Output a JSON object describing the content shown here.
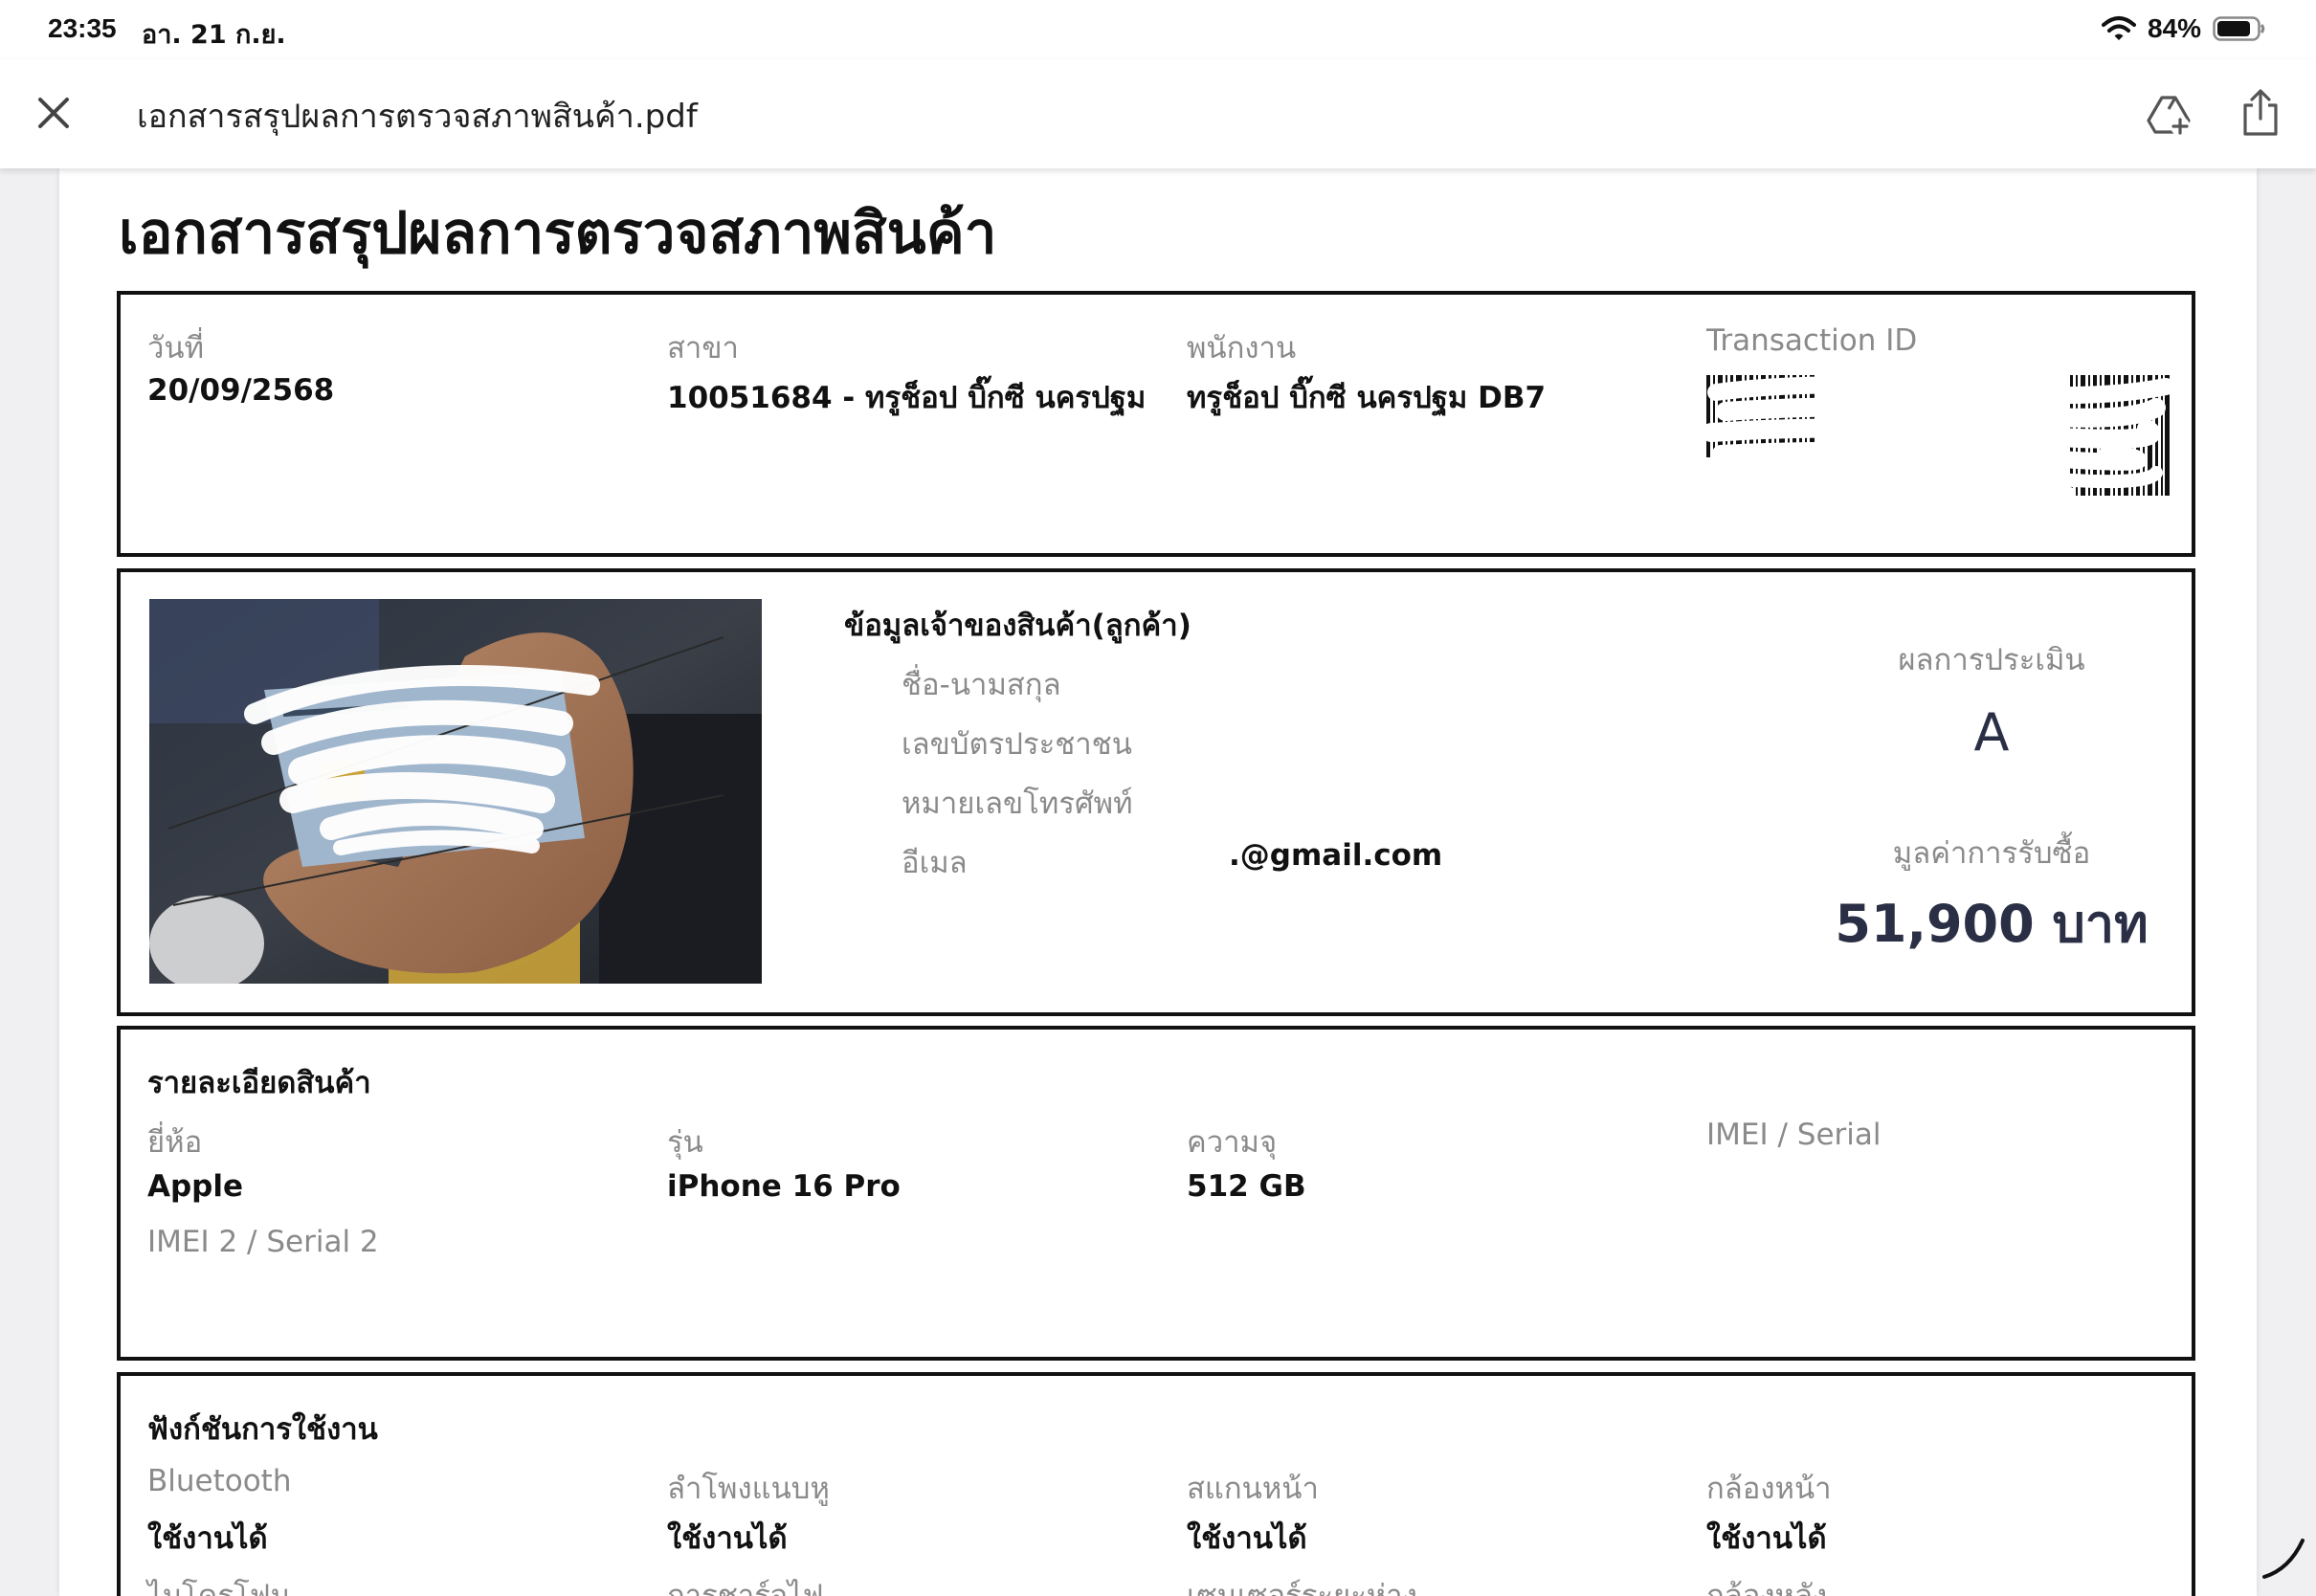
{
  "status_bar": {
    "time": "23:35",
    "date": "อา. 21 ก.ย.",
    "battery": "84%"
  },
  "nav": {
    "title": "เอกสารสรุปผลการตรวจสภาพสินค้า.pdf"
  },
  "document": {
    "title": "เอกสารสรุปผลการตรวจสภาพสินค้า",
    "transaction": {
      "date_label": "วันที่",
      "date_value": "20/09/2568",
      "branch_label": "สาขา",
      "branch_value": "10051684 - ทรูช็อป บิ๊กซี นครปฐม",
      "staff_label": "พนักงาน",
      "staff_value": "ทรูช็อป บิ๊กซี นครปฐม DB7",
      "transaction_id_label": "Transaction ID"
    },
    "customer": {
      "heading": "ข้อมูลเจ้าของสินค้า(ลูกค้า)",
      "name_label": "ชื่อ-นามสกุล",
      "id_card_label": "เลขบัตรประชาชน",
      "phone_label": "หมายเลขโทรศัพท์",
      "email_label": "อีเมล",
      "email_value": ".@gmail.com",
      "grade_label": "ผลการประเมิน",
      "grade_value": "A",
      "price_label": "มูลค่าการรับซื้อ",
      "price_value": "51,900 บาท"
    },
    "product": {
      "heading": "รายละเอียดสินค้า",
      "brand_label": "ยี่ห้อ",
      "brand_value": "Apple",
      "model_label": "รุ่น",
      "model_value": "iPhone 16 Pro",
      "capacity_label": "ความจุ",
      "capacity_value": "512 GB",
      "imei_label": "IMEI / Serial",
      "imei2_label": "IMEI 2 / Serial 2"
    },
    "functions": {
      "heading": "ฟังก์ชันการใช้งาน",
      "items": [
        {
          "label": "Bluetooth",
          "value": "ใช้งานได้"
        },
        {
          "label": "ลำโพงแนบหู",
          "value": "ใช้งานได้"
        },
        {
          "label": "สแกนหน้า",
          "value": "ใช้งานได้"
        },
        {
          "label": "กล้องหน้า",
          "value": "ใช้งานได้"
        }
      ],
      "next_row_labels": [
        "ไมโครโฟน",
        "การชาร์จไฟ",
        "เซนเซอร์ระยะห่าง",
        "กล้องหลัง"
      ]
    }
  }
}
